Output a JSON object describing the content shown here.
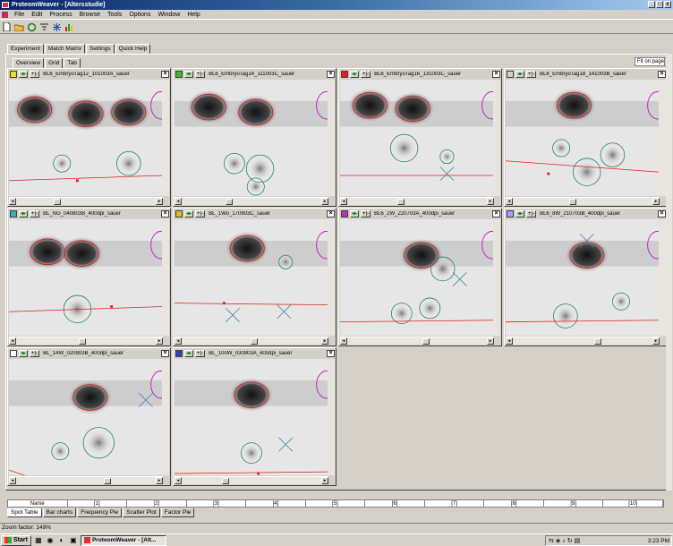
{
  "window": {
    "title": "ProteomWeaver - [Altersstudie]",
    "controls": [
      "_",
      "□",
      "x"
    ]
  },
  "menu": [
    "File",
    "Edit",
    "Process",
    "Browse",
    "Tools",
    "Options",
    "Window",
    "Help"
  ],
  "main_tabs": [
    "Experiment",
    "Match Matrix",
    "Settings",
    "Quick Help"
  ],
  "sub_tabs": [
    "Overview",
    "Grid",
    "Tab"
  ],
  "fit_select": {
    "value": "Fit on page"
  },
  "panels": [
    {
      "title": "BL6_EmbryoTag12_101003A_sauer",
      "swatch": "#e8e020"
    },
    {
      "title": "BL6_EmbryoTag14_111003C_sauer",
      "swatch": "#30c030"
    },
    {
      "title": "BL6_EmbryoTag16_131003C_sauer",
      "swatch": "#e02020"
    },
    {
      "title": "BL6_EmbryoTag18_141003B_sauer",
      "swatch": "#d4d0c8"
    },
    {
      "title": "BL_NG_040803B_400dpi_sauer",
      "swatch": "#30b0c0"
    },
    {
      "title": "BL_1Wo_170903C_sauer",
      "swatch": "#e0c020"
    },
    {
      "title": "BL6_2W_220703A_400dpi_sauer",
      "swatch": "#c030c0"
    },
    {
      "title": "BL6_8W_210703B_400dpi_sauer",
      "swatch": "#a0a0ff"
    },
    {
      "title": "BL_14W_020903B_400dpi_sauer",
      "swatch": "#ffffff"
    },
    {
      "title": "BL_100W_030903A_400dpi_sauer",
      "swatch": "#3040c0"
    }
  ],
  "bottom_columns": [
    "Name",
    "[1]",
    "[2]",
    "[3]",
    "[4]",
    "[5]",
    "[6]",
    "[7]",
    "[8]",
    "[9]",
    "[10]"
  ],
  "bottom_tabs": [
    "Spot Table",
    "Bar charts",
    "Frequency Pie",
    "Scatter Plot",
    "Factor Pie"
  ],
  "status": {
    "zoom": "Zoom factor: 149%"
  },
  "taskbar": {
    "start": "Start",
    "task": "ProteomWeaver - [Alt...",
    "clock": "3:23 PM"
  }
}
